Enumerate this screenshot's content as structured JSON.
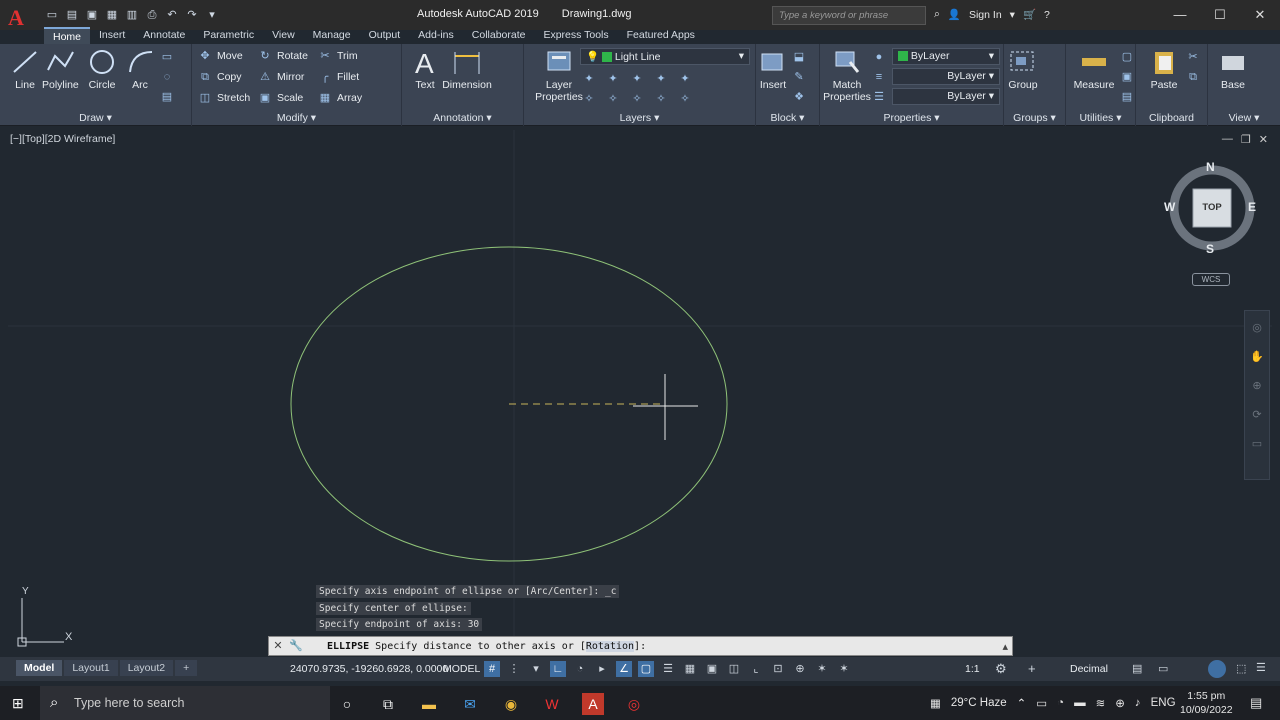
{
  "window": {
    "app_name": "Autodesk AutoCAD 2019",
    "file_name": "Drawing1.dwg",
    "search_placeholder": "Type a keyword or phrase",
    "sign_in": "Sign In"
  },
  "tabs": [
    "Home",
    "Insert",
    "Annotate",
    "Parametric",
    "View",
    "Manage",
    "Output",
    "Add-ins",
    "Collaborate",
    "Express Tools",
    "Featured Apps"
  ],
  "ribbon": {
    "draw": {
      "label": "Draw",
      "line": "Line",
      "polyline": "Polyline",
      "circle": "Circle",
      "arc": "Arc"
    },
    "modify": {
      "label": "Modify",
      "move": "Move",
      "rotate": "Rotate",
      "trim": "Trim",
      "copy": "Copy",
      "mirror": "Mirror",
      "fillet": "Fillet",
      "stretch": "Stretch",
      "scale": "Scale",
      "array": "Array"
    },
    "annotation": {
      "label": "Annotation",
      "text": "Text",
      "dimension": "Dimension"
    },
    "layers": {
      "label": "Layers",
      "layer_properties_1": "Layer",
      "layer_properties_2": "Properties",
      "current_layer": "Light Line"
    },
    "block": {
      "label": "Block",
      "insert": "Insert"
    },
    "properties": {
      "label": "Properties",
      "match_1": "Match",
      "match_2": "Properties",
      "color": "ByLayer",
      "linetype": "ByLayer",
      "lineweight": "ByLayer"
    },
    "groups": {
      "label": "Groups",
      "group": "Group"
    },
    "utilities": {
      "label": "Utilities",
      "measure": "Measure"
    },
    "clipboard": {
      "label": "Clipboard",
      "paste": "Paste"
    },
    "view": {
      "label": "View",
      "base": "Base"
    }
  },
  "viewport": {
    "label": "[−][Top][2D Wireframe]",
    "viewcube": {
      "n": "N",
      "s": "S",
      "e": "E",
      "w": "W",
      "face": "TOP"
    },
    "wcs": "WCS",
    "ucs_x": "X",
    "ucs_y": "Y"
  },
  "command": {
    "history": [
      "Specify axis endpoint of ellipse or [Arc/Center]: _c",
      "Specify center of ellipse:",
      "Specify endpoint of axis: 30"
    ],
    "current_cmd": "ELLIPSE",
    "prompt": "Specify distance to other axis or [",
    "option": "Rotation",
    "prompt_end": "]:"
  },
  "status": {
    "layouts": [
      "Model",
      "Layout1",
      "Layout2"
    ],
    "coords": "24070.9735, -19260.6928, 0.0000",
    "model": "MODEL",
    "scale": "1:1",
    "units": "Decimal"
  },
  "taskbar": {
    "search": "Type here to search",
    "weather": "29°C Haze",
    "lang": "ENG",
    "time": "1:55 pm",
    "date": "10/09/2022"
  },
  "colors": {
    "ellipse": "#8fc278",
    "axis_line": "#c8b45a",
    "accent": "#3f6fa3"
  }
}
